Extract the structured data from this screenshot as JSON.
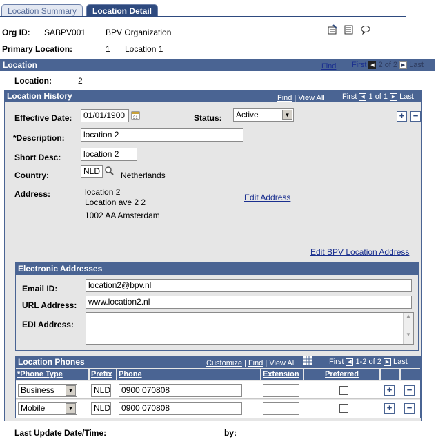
{
  "tabs": [
    {
      "label": "Location Summary"
    },
    {
      "label": "Location Detail"
    }
  ],
  "header": {
    "org_id_label": "Org ID:",
    "org_id": "SABPV001",
    "org_name": "BPV Organization",
    "primary_location_label": "Primary Location:",
    "primary_location_num": "1",
    "primary_location_name": "Location 1",
    "icons": [
      "edit-icon",
      "notes-icon",
      "comment-icon"
    ]
  },
  "location_bar": {
    "title": "Location",
    "find": "Find",
    "first": "First",
    "counter": "2 of 2",
    "last": "Last"
  },
  "location": {
    "label": "Location:",
    "value": "2"
  },
  "history_bar": {
    "title": "Location History",
    "find": "Find",
    "view_all": "View All",
    "first": "First",
    "counter": "1 of 1",
    "last": "Last"
  },
  "form": {
    "effective_date_label": "Effective Date:",
    "effective_date": "01/01/1900",
    "status_label": "Status:",
    "status": "Active",
    "description_label": "*Description:",
    "description": "location 2",
    "short_desc_label": "Short Desc:",
    "short_desc": "location 2",
    "country_label": "Country:",
    "country_code": "NLD",
    "country_name": "Netherlands",
    "address_label": "Address:",
    "address_line1": "location 2",
    "address_line2": "Location ave 2 2",
    "address_line3": "1002 AA Amsterdam",
    "edit_address": "Edit Address",
    "edit_bpv_address": "Edit BPV Location Address"
  },
  "electronic": {
    "title": "Electronic Addresses",
    "email_label": "Email ID:",
    "email": "location2@bpv.nl",
    "url_label": "URL Address:",
    "url": "www.location2.nl",
    "edi_label": "EDI Address:",
    "edi": ""
  },
  "phones": {
    "title": "Location Phones",
    "customize": "Customize",
    "find": "Find",
    "view_all": "View All",
    "first": "First",
    "counter": "1-2 of 2",
    "last": "Last",
    "columns": [
      "*Phone Type",
      "Prefix",
      "Phone",
      "Extension",
      "Preferred"
    ],
    "rows": [
      {
        "type": "Business",
        "prefix": "NLD",
        "phone": "0900 070808",
        "extension": "",
        "preferred": false
      },
      {
        "type": "Mobile",
        "prefix": "NLD",
        "phone": "0900 070808",
        "extension": "",
        "preferred": false
      }
    ]
  },
  "footer": {
    "last_update_label": "Last Update Date/Time:",
    "by_label": "by:"
  }
}
